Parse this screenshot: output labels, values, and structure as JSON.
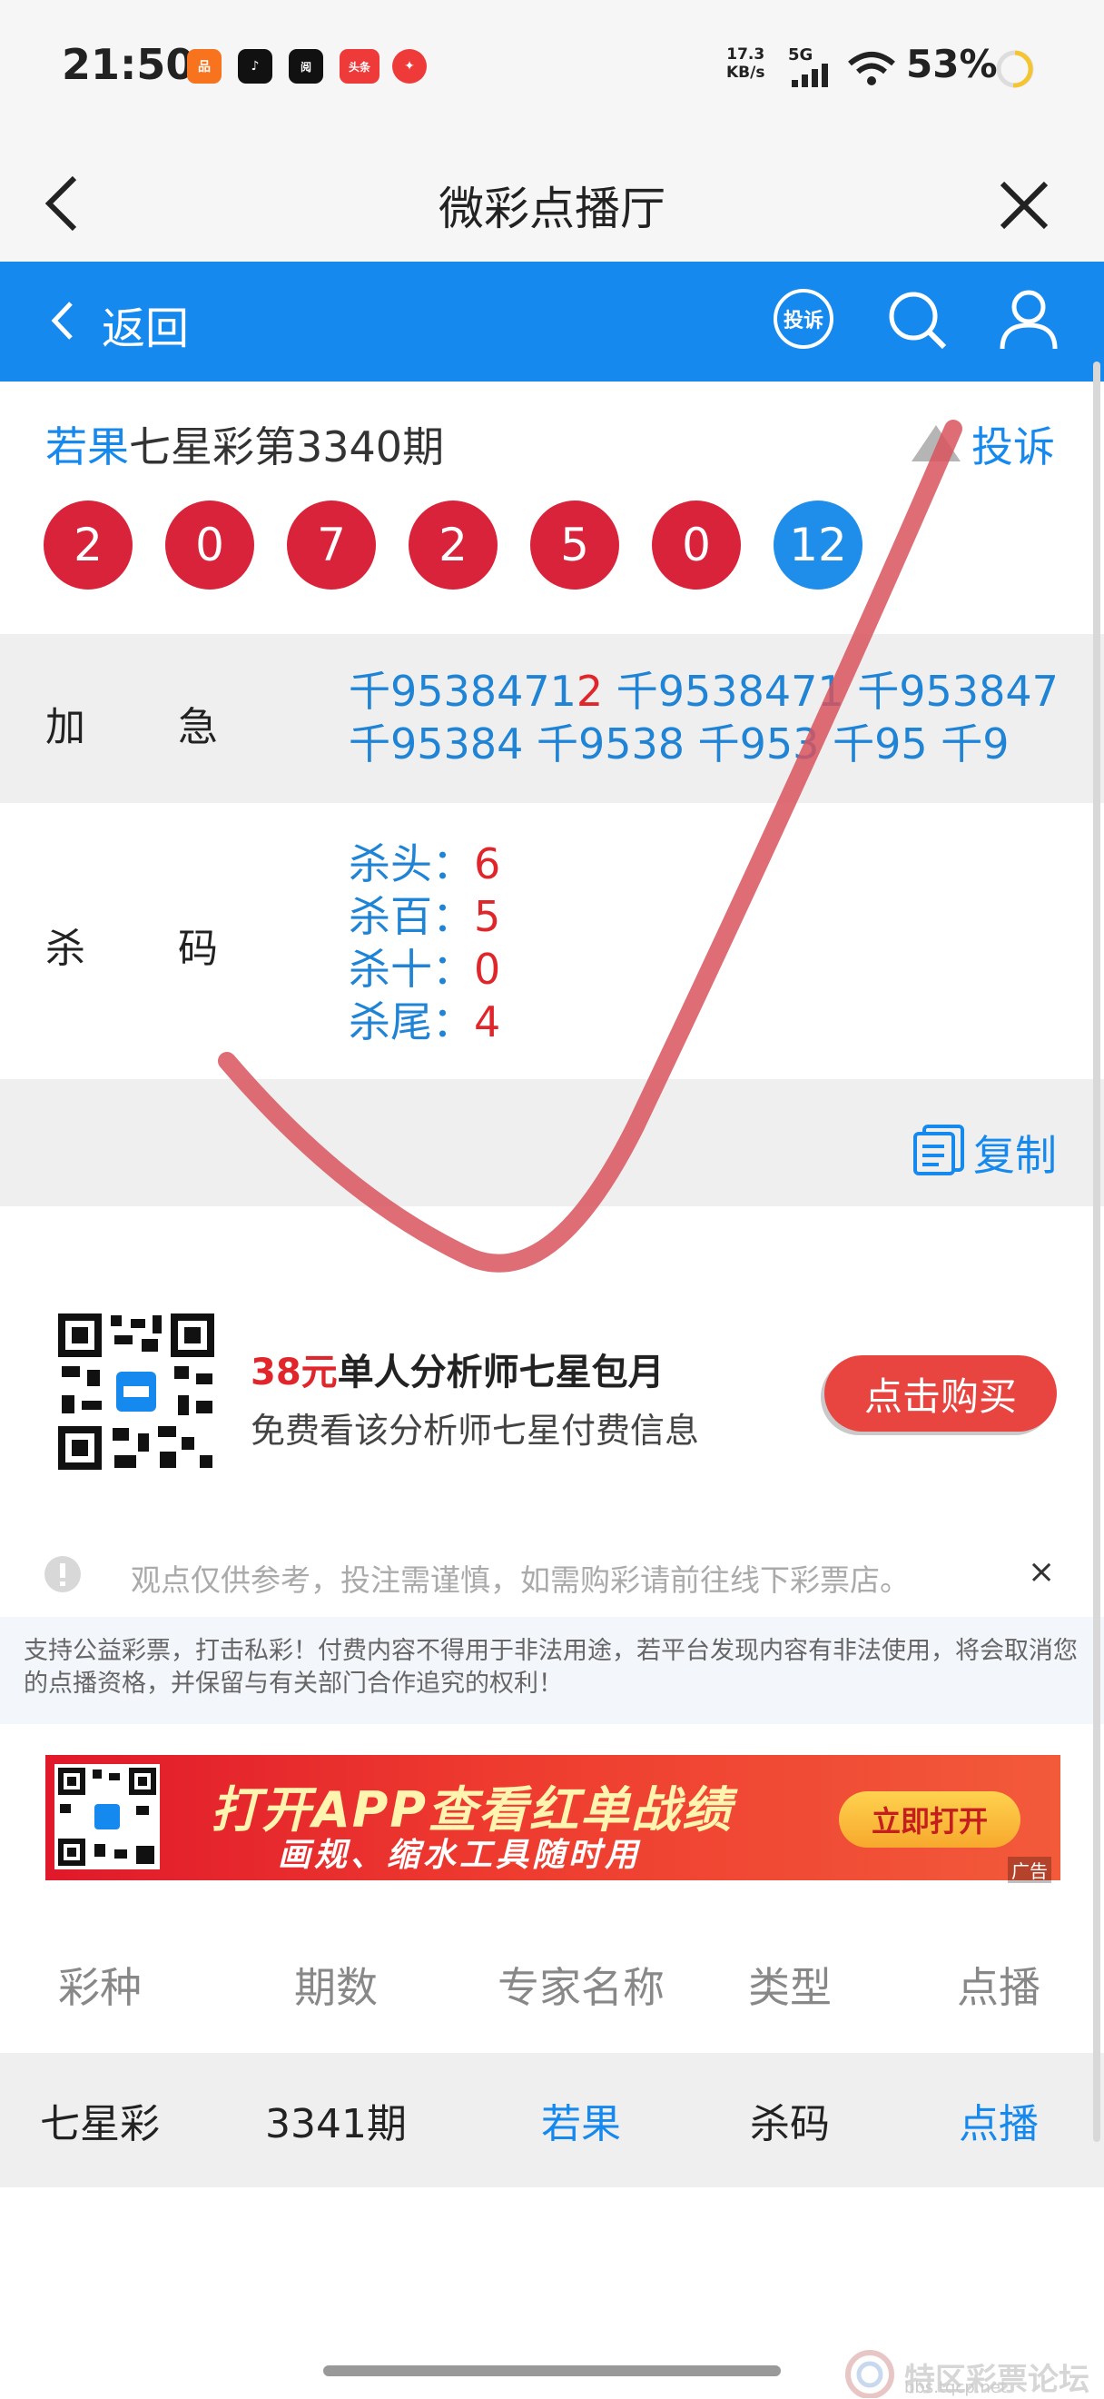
{
  "status_bar": {
    "time": "21:50",
    "speed": "17.3",
    "speed_unit": "KB/s",
    "network": "5G",
    "battery": "53%",
    "apps": [
      {
        "name": "app-1",
        "color": "#f7731d",
        "glyph": "品"
      },
      {
        "name": "tiktok",
        "color": "#111111",
        "glyph": "♪"
      },
      {
        "name": "app-3",
        "color": "#111111",
        "glyph": "阅"
      },
      {
        "name": "toutiao",
        "color": "#ef3a3a",
        "glyph": "头条"
      },
      {
        "name": "app-5",
        "color": "#ef3a3a",
        "glyph": "✦"
      }
    ]
  },
  "title_bar": {
    "title": "微彩点播厅"
  },
  "nav": {
    "back_label": "返回",
    "complain_icon_text": "投诉"
  },
  "header": {
    "author": "若果",
    "title_rest": "七星彩第3340期",
    "complain_label": "投诉",
    "balls": [
      {
        "value": "2",
        "color": "red"
      },
      {
        "value": "0",
        "color": "red"
      },
      {
        "value": "7",
        "color": "red"
      },
      {
        "value": "2",
        "color": "red"
      },
      {
        "value": "5",
        "color": "red"
      },
      {
        "value": "0",
        "color": "red"
      },
      {
        "value": "12",
        "color": "blue"
      }
    ]
  },
  "rows": {
    "jiaji": {
      "label_1": "加",
      "label_2": "急",
      "line1_a": "千9538471",
      "line1_red": "2",
      "line1_b": " 千9538471 千953847",
      "line2": "千95384 千9538 千953 千95 千9"
    },
    "shama": {
      "label_1": "杀",
      "label_2": "码",
      "items": [
        {
          "label": "杀头：",
          "value": "6"
        },
        {
          "label": "杀百：",
          "value": "5"
        },
        {
          "label": "杀十：",
          "value": "0"
        },
        {
          "label": "杀尾：",
          "value": "4"
        }
      ]
    }
  },
  "copy": {
    "label": "复制"
  },
  "promo": {
    "price": "38元",
    "title_rest": "单人分析师七星包月",
    "subtitle": "免费看该分析师七星付费信息",
    "button": "点击购买"
  },
  "notice": {
    "text": "观点仅供参考，投注需谨慎，如需购彩请前往线下彩票店。",
    "close": "×"
  },
  "disclaimer": "支持公益彩票，打击私彩！付费内容不得用于非法用途，若平台发现内容有非法使用，将会取消您的点播资格，并保留与有关部门合作追究的权利！",
  "banner": {
    "title": "打开APP查看红单战绩",
    "subtitle": "画规、缩水工具随时用",
    "button": "立即打开",
    "ad_tag": "广告"
  },
  "table": {
    "headers": [
      "彩种",
      "期数",
      "专家名称",
      "类型",
      "点播"
    ],
    "rows": [
      [
        "七星彩",
        "3341期",
        "若果",
        "杀码",
        "点播"
      ]
    ]
  },
  "watermark": {
    "title": "特区彩票论坛",
    "sub": "bbs.tqcp.net"
  }
}
